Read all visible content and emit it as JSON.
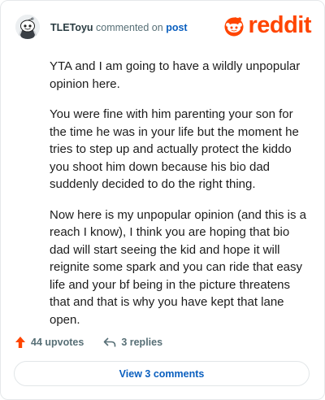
{
  "comment": {
    "username": "TLEToyu",
    "action_text": "commented on",
    "post_link": "post",
    "paragraphs": [
      "YTA and I am going to have a wildly unpopular opinion here.",
      "You were fine with him parenting your son for the time he was in your life but the moment he tries to step up and actually protect the kiddo you shoot him down because his bio dad suddenly decided to do the right thing.",
      "Now here is my unpopular opinion (and this is a reach I know), I think you are hoping that bio dad will start seeing the kid and hope it will reignite some spark and you can ride that easy life and your bf being in the picture threatens that and that is why you have kept that lane open."
    ]
  },
  "brand": {
    "logo_text": "reddit",
    "color": "#ff4500"
  },
  "actions": {
    "upvotes": "44 upvotes",
    "replies": "3 replies",
    "view_comments": "View 3 comments"
  },
  "icons": {
    "avatar": "snoo-avatar-icon",
    "logo": "reddit-snoo-icon",
    "upvote": "upvote-arrow-icon",
    "reply": "reply-arrow-icon"
  }
}
